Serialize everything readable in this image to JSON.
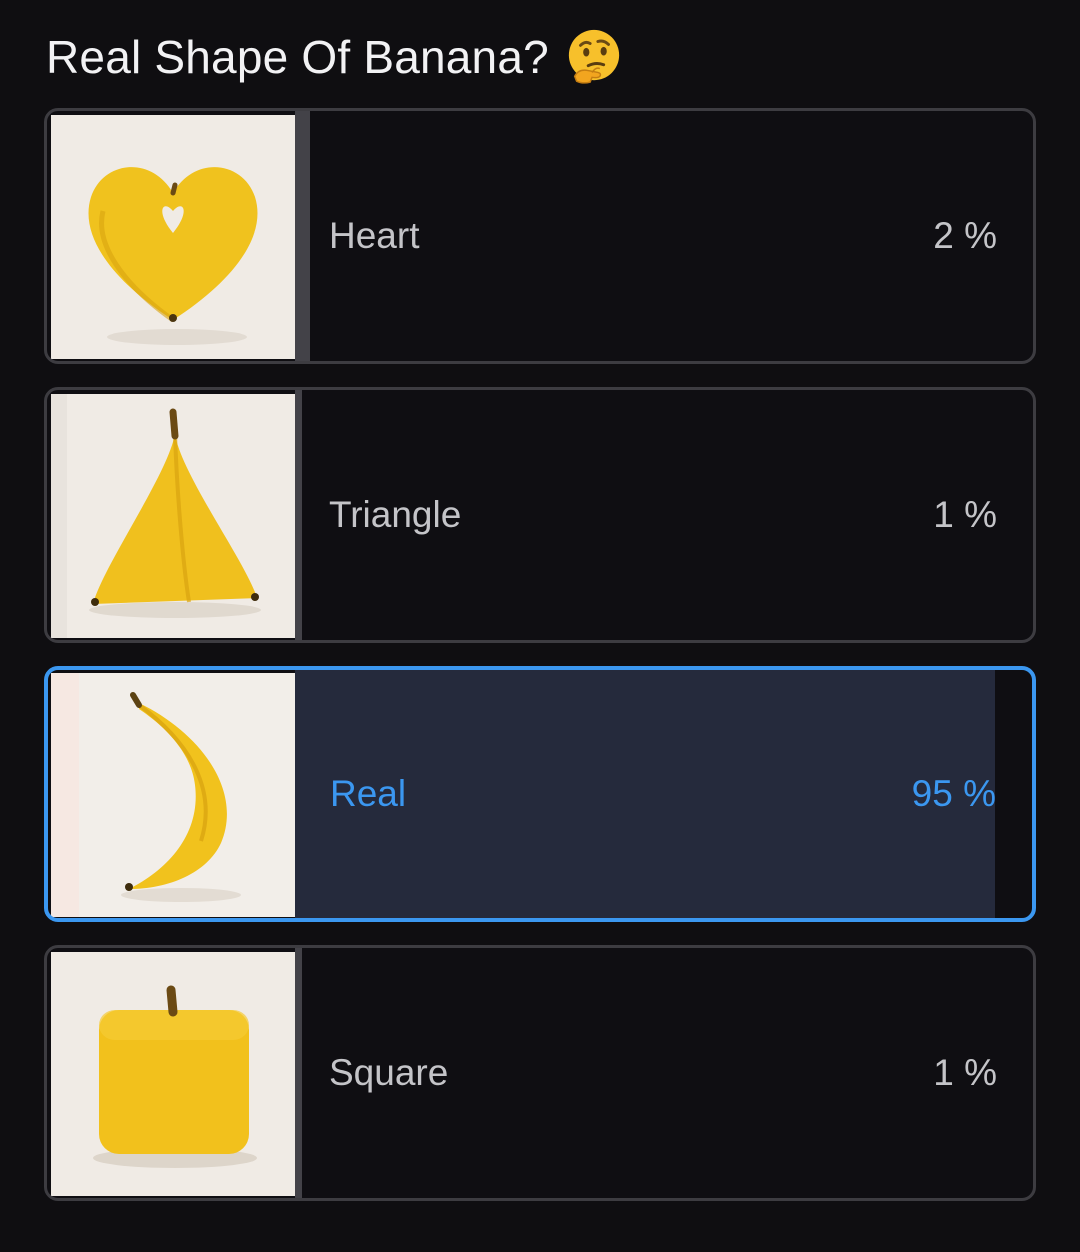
{
  "poll": {
    "question": "Real Shape Of Banana?",
    "question_emoji": "thinking-face-emoji",
    "accent_color": "#3b97f0",
    "options": [
      {
        "label": "Heart",
        "percent_text": "2 %",
        "percent": 2,
        "selected": false,
        "image": "heart-shaped-banana"
      },
      {
        "label": "Triangle",
        "percent_text": "1 %",
        "percent": 1,
        "selected": false,
        "image": "triangle-shaped-banana"
      },
      {
        "label": "Real",
        "percent_text": "95 %",
        "percent": 95,
        "selected": true,
        "image": "real-banana"
      },
      {
        "label": "Square",
        "percent_text": "1 %",
        "percent": 1,
        "selected": false,
        "image": "square-shaped-banana"
      }
    ]
  }
}
